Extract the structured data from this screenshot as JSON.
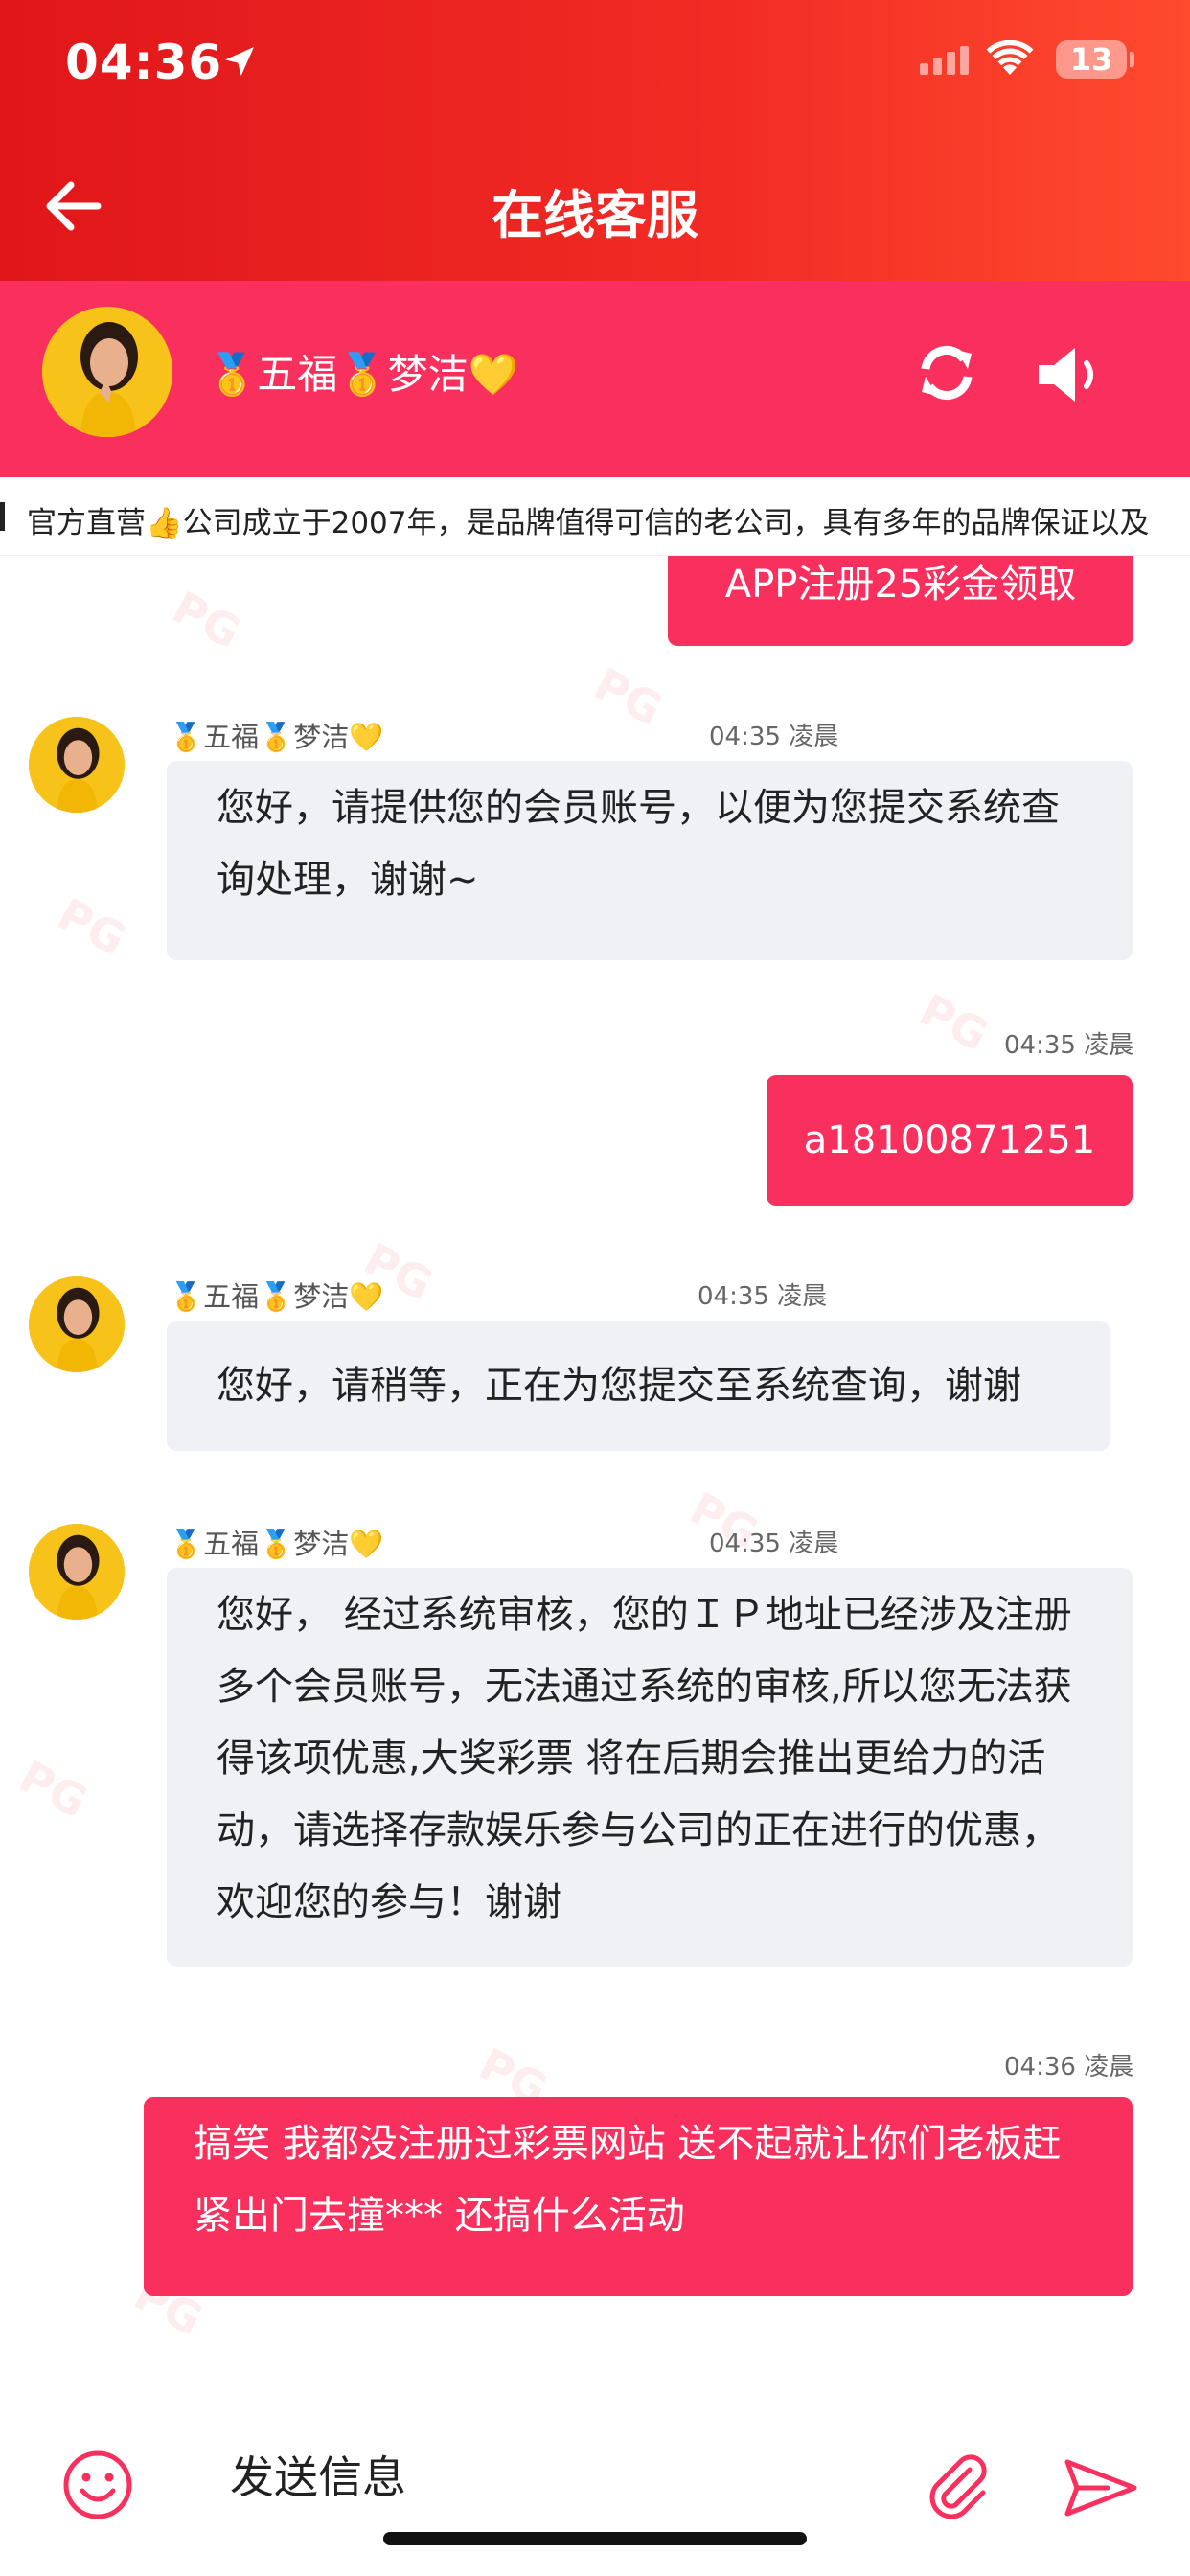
{
  "status_bar": {
    "time": "04:36",
    "battery": "13"
  },
  "header": {
    "title": "在线客服"
  },
  "agent": {
    "name": "🥇五福🥇梦洁💛"
  },
  "ticker": {
    "text": "官方直营👍公司成立于2007年，是品牌值得可信的老公司，具有多年的品牌保证以及"
  },
  "messages": [
    {
      "from": "me",
      "time": "",
      "text": "APP注册25彩金领取"
    },
    {
      "from": "agent",
      "name": "🥇五福🥇梦洁💛",
      "time": "04:35 凌晨",
      "text": "您好，请提供您的会员账号，以便为您提交系统查询处理，谢谢~"
    },
    {
      "from": "me",
      "time": "04:35 凌晨",
      "text": "a18100871251"
    },
    {
      "from": "agent",
      "name": "🥇五福🥇梦洁💛",
      "time": "04:35 凌晨",
      "text": "您好，请稍等，正在为您提交至系统查询，谢谢"
    },
    {
      "from": "agent",
      "name": "🥇五福🥇梦洁💛",
      "time": "04:35 凌晨",
      "text": "您好， 经过系统审核，您的ＩＰ地址已经涉及注册多个会员账号，无法通过系统的审核,所以您无法获得该项优惠,大奖彩票 将在后期会推出更给力的活动，请选择存款娱乐参与公司的正在进行的优惠，欢迎您的参与！谢谢"
    },
    {
      "from": "me",
      "time": "04:36 凌晨",
      "text": "搞笑 我都没注册过彩票网站 送不起就让你们老板赶紧出门去撞*** 还搞什么活动"
    }
  ],
  "composer": {
    "placeholder": "发送信息"
  },
  "watermark": "PG",
  "colors": {
    "header_red": "#e0161a",
    "accent_pink": "#f9305d",
    "bubble_gray": "#eff1f4",
    "avatar_yellow": "#f7c21a"
  },
  "icons": [
    "location-arrow-icon",
    "signal-icon",
    "wifi-icon",
    "back-arrow-icon",
    "refresh-icon",
    "speaker-icon",
    "emoji-icon",
    "paperclip-icon",
    "send-icon"
  ]
}
